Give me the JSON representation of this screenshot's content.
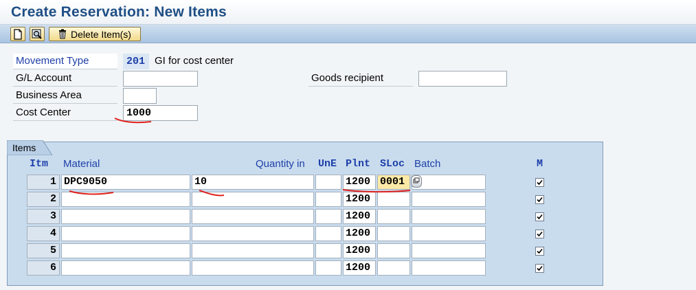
{
  "window": {
    "title": "Create Reservation: New Items"
  },
  "toolbar": {
    "new_icon": "document-icon",
    "find_icon": "find-icon",
    "delete_icon": "trash-icon",
    "delete_label": "Delete Item(s)"
  },
  "header": {
    "movement_type": {
      "label": "Movement Type",
      "value": "201",
      "description": "GI for cost center"
    },
    "gl_account": {
      "label": "G/L Account",
      "value": ""
    },
    "goods_recipient": {
      "label": "Goods recipient",
      "value": ""
    },
    "business_area": {
      "label": "Business Area",
      "value": ""
    },
    "cost_center": {
      "label": "Cost Center",
      "value": "1000"
    }
  },
  "items": {
    "tab_label": "Items",
    "columns": {
      "itm": "Itm",
      "material": "Material",
      "quantity": "Quantity in",
      "une": "UnE",
      "plnt": "Plnt",
      "sloc": "SLoc",
      "batch": "Batch",
      "m": "M"
    },
    "rows": [
      {
        "itm": "1",
        "material": "DPC9050",
        "quantity": "10",
        "une": "",
        "plnt": "1200",
        "sloc": "0001",
        "batch": "",
        "m": true
      },
      {
        "itm": "2",
        "material": "",
        "quantity": "",
        "une": "",
        "plnt": "1200",
        "sloc": "",
        "batch": "",
        "m": true
      },
      {
        "itm": "3",
        "material": "",
        "quantity": "",
        "une": "",
        "plnt": "1200",
        "sloc": "",
        "batch": "",
        "m": true
      },
      {
        "itm": "4",
        "material": "",
        "quantity": "",
        "une": "",
        "plnt": "1200",
        "sloc": "",
        "batch": "",
        "m": true
      },
      {
        "itm": "5",
        "material": "",
        "quantity": "",
        "une": "",
        "plnt": "1200",
        "sloc": "",
        "batch": "",
        "m": true
      },
      {
        "itm": "6",
        "material": "",
        "quantity": "",
        "une": "",
        "plnt": "1200",
        "sloc": "",
        "batch": "",
        "m": true
      }
    ]
  },
  "colors": {
    "title": "#1f4f86",
    "label_blue": "#1d3fa8",
    "items_bg": "#c9dcee",
    "annotation": "#e0211c"
  }
}
